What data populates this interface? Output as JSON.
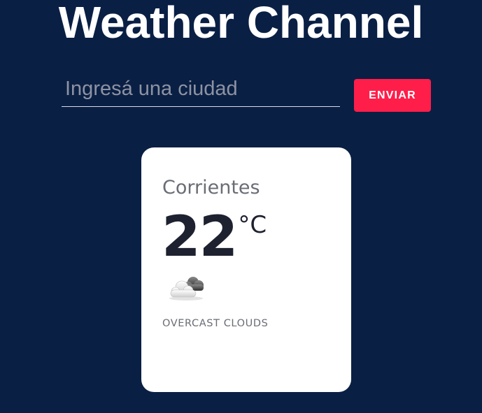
{
  "header": {
    "title": "Weather Channel"
  },
  "search": {
    "placeholder": "Ingresá una ciudad",
    "value": "",
    "submit_label": "ENVIAR"
  },
  "weather": {
    "city": "Corrientes",
    "temperature": "22",
    "unit": "°C",
    "icon": "overcast-clouds-icon",
    "description": "OVERCAST CLOUDS"
  },
  "colors": {
    "background": "#0a1f44",
    "accent": "#ff1e4a",
    "card": "#ffffff"
  }
}
